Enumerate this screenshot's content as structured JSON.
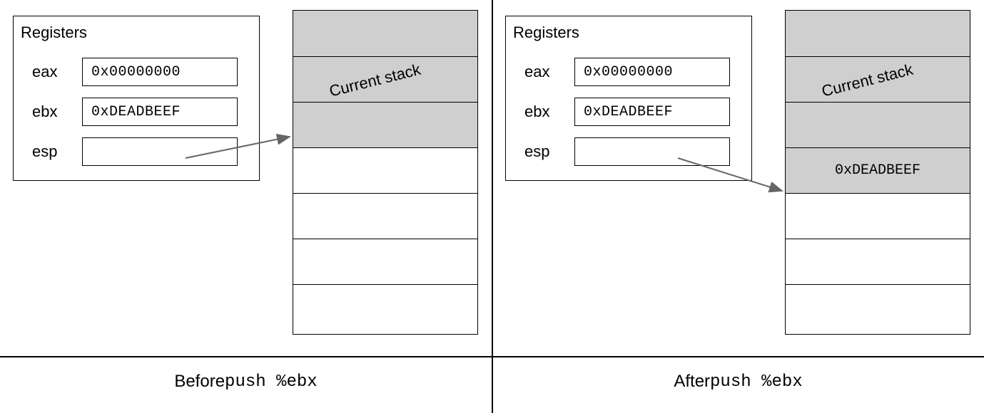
{
  "title_registers": "Registers",
  "registers": {
    "eax": {
      "name": "eax",
      "value": "0x00000000"
    },
    "ebx": {
      "name": "ebx",
      "value": "0xDEADBEEF"
    },
    "esp": {
      "name": "esp",
      "value": ""
    }
  },
  "stack_label": "Current stack",
  "before": {
    "shaded_cells": 3,
    "cell_text": [
      "",
      "",
      "",
      "",
      "",
      "",
      ""
    ],
    "caption_prefix": "Before ",
    "caption_code": "push %ebx"
  },
  "after": {
    "shaded_cells": 4,
    "cell_text": [
      "",
      "",
      "",
      "0xDEADBEEF",
      "",
      "",
      ""
    ],
    "caption_prefix": "After ",
    "caption_code": "push %ebx"
  }
}
